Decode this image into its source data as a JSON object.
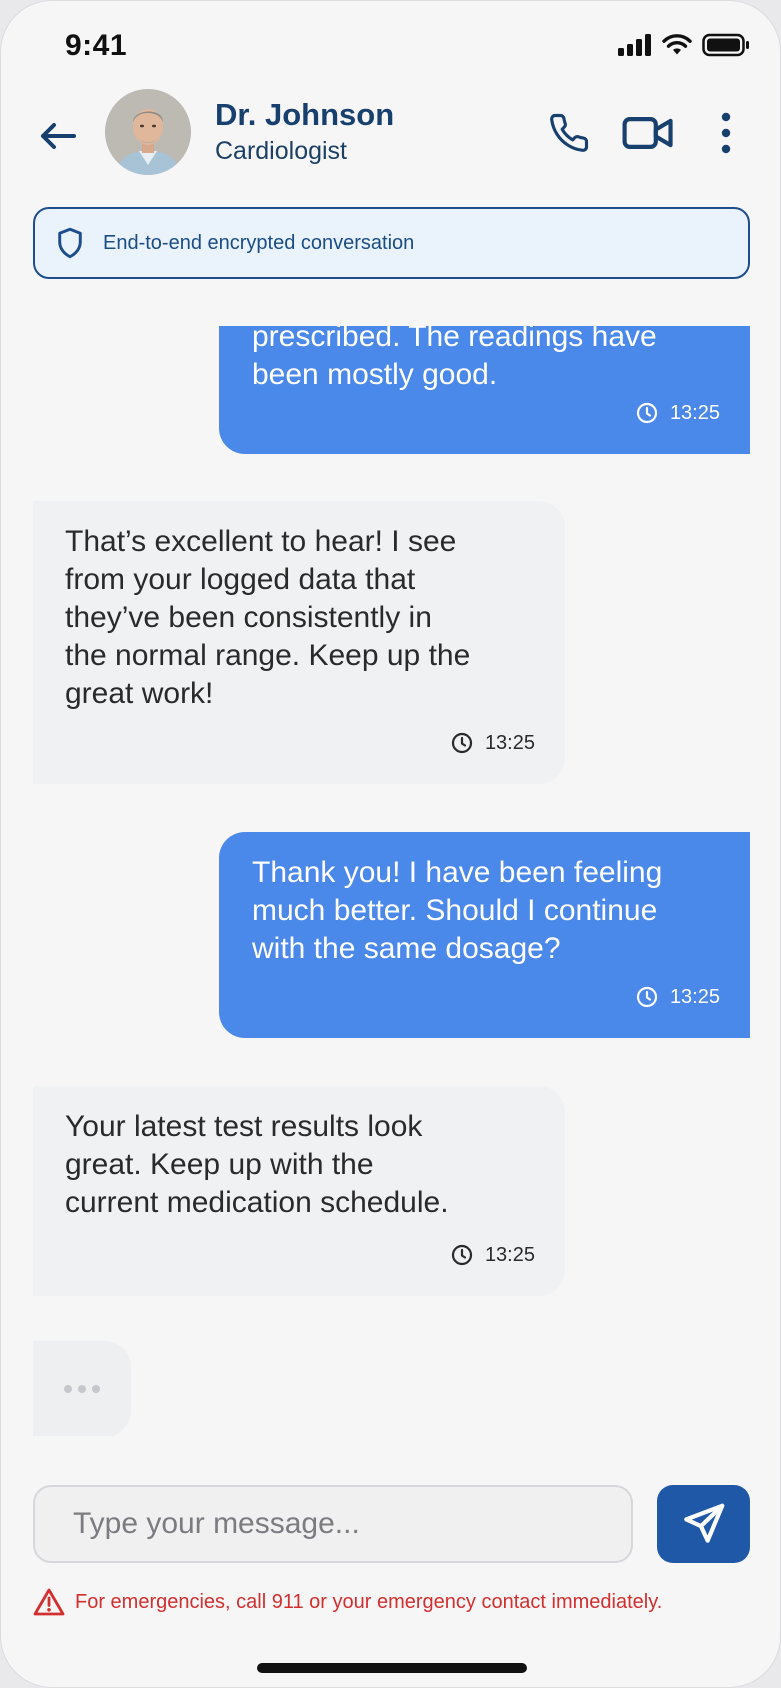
{
  "status_bar": {
    "time": "9:41"
  },
  "header": {
    "name": "Dr. Johnson",
    "role": "Cardiologist"
  },
  "banner": {
    "text": "End-to-end encrypted conversation"
  },
  "messages": [
    {
      "direction": "outgoing",
      "text": "prescribed. The readings have\nbeen mostly good.",
      "time": "13:25"
    },
    {
      "direction": "incoming",
      "text": "That’s excellent to hear! I see\nfrom your logged data that\nthey’ve been consistently in\nthe normal range. Keep up the\ngreat work!",
      "time": "13:25"
    },
    {
      "direction": "outgoing",
      "text": "Thank you! I have been feeling\nmuch better. Should I continue\nwith the same dosage?",
      "time": "13:25"
    },
    {
      "direction": "incoming",
      "text": "Your latest test results look\ngreat. Keep up with the\ncurrent medication schedule.",
      "time": "13:25"
    }
  ],
  "composer": {
    "placeholder": "Type your message..."
  },
  "emergency": {
    "text": "For emergencies, call 911 or your emergency contact immediately."
  },
  "icons": {
    "back": "arrow-left-icon",
    "call": "phone-icon",
    "video": "video-camera-icon",
    "more": "more-vertical-icon",
    "shield": "shield-icon",
    "clock": "clock-icon",
    "send": "send-icon",
    "warning": "warning-triangle-icon"
  },
  "colors": {
    "outgoing_bubble": "#4a88ea",
    "incoming_bubble": "#f0f1f3",
    "brand_dark": "#18406e",
    "send_button": "#2058a8",
    "emergency": "#d32f2f"
  }
}
